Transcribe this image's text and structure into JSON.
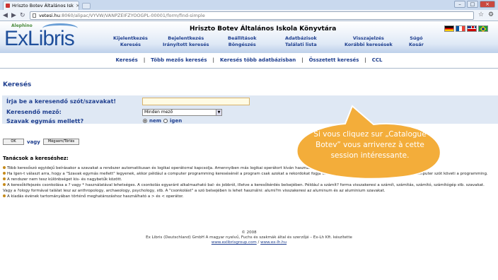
{
  "browser": {
    "tab_title": "Hriszto Botev Általános Isk",
    "tab_close": "×",
    "url_host": "vetesi.hu",
    "url_path": ":8060/alipac/VYVW/VANPZEIFZYOOGPL-00001/form/find-simple",
    "back": "◀",
    "forward": "▶",
    "reload": "↻",
    "star": "☆",
    "wrench": "⚙",
    "win_min": "–",
    "win_max": "□",
    "win_close": "×"
  },
  "header": {
    "logo_small": "Alephino",
    "logo_main": "ExLibris",
    "library_name": "Hriszto Botev Általános Iskola Könyvtára",
    "menu": [
      {
        "top": "Kijelentkezés",
        "bottom": "Keresés"
      },
      {
        "top": "Bejelentkezés",
        "bottom": "Irányított keresés"
      },
      {
        "top": "Beállítások",
        "bottom": "Böngészés"
      },
      {
        "top": "Adatbázisok",
        "bottom": "Találati lista"
      },
      {
        "top": "Visszajelzés",
        "bottom": "Korábbi keresések"
      },
      {
        "top": "Súgó",
        "bottom": "Kosár"
      }
    ],
    "flags": [
      "flag-de",
      "flag-fr",
      "flag-gb",
      "flag-br"
    ]
  },
  "links": [
    "Keresés",
    "Több mezős keresés",
    "Keresés több adatbázisban",
    "Összetett keresés",
    "CCL"
  ],
  "links_sep": "|",
  "search": {
    "title": "Keresés",
    "label_query": "Írja be a keresendő szót/szavakat!",
    "query_value": "",
    "label_field": "Keresendő mező:",
    "field_value": "Minden mező",
    "label_adjacent": "Szavak egymás mellett?",
    "radio_no": "nem",
    "radio_yes": "igen",
    "selected": "nem",
    "ok_label": "OK",
    "or_label": "vagy",
    "clear_label": "Mégsem/Törlés"
  },
  "tips": {
    "title": "Tanácsok a kereséshez:",
    "items": [
      "Több keresőszó egyidejű beírásakor a szavakat a rendszer automatikusan és logikai operátorral kapcsolja. Amennyiben más logikai operátort kíván használni, írja be a következőt: OR és NOT.",
      "Ha Igen-t választ arra, hogy a \"Szavak egymás mellett\" legyenek, akkor például a computer programming keresésénél a program csak azokat a rekordokat fogja kikeresni, ahol a computer szót, amelyekben a computer szót követi a programming.",
      "A rendszer nem tesz különbséget kis- és nagybetűk között.",
      "A keresőkifejezés csonkolása a ? vagy * használatával lehetséges. A csonkolás egyaránt alkalmazható bal- és jobbról, illetve a keresőkérdés belsejében. Például a számít? forma visszakeresi a számít, számítás, számító, számítógép stb. szavakat. Vagy a ?ology formával találat lesz az anthropology, archaeology, psychology, stb. A \"csonkolást\" a szó belsejében is lehet használni: alumi?m visszakeresi az aluminum és az aluminium szavakat.",
      "A kiadás évének tartományában történő meghatározáshoz használható a > és < operátor."
    ]
  },
  "footer": {
    "copyright": "© 2008",
    "line2": "Ex Libris (Deutschland) GmbH A magyar nyelvű, Fuchs és szakmák által és szerzőjé – Ex-Lh Kft. készítette",
    "link1": "www.exlibrisgroup.com",
    "link2": "www.ex-lh.hu"
  },
  "callout": {
    "lines": [
      "Si vous cliquez sur „Catalogue",
      "Botev” vous arriverez à cette",
      "session intéressante."
    ],
    "fill": "#f3ad3a",
    "stroke": "#ffffff"
  }
}
